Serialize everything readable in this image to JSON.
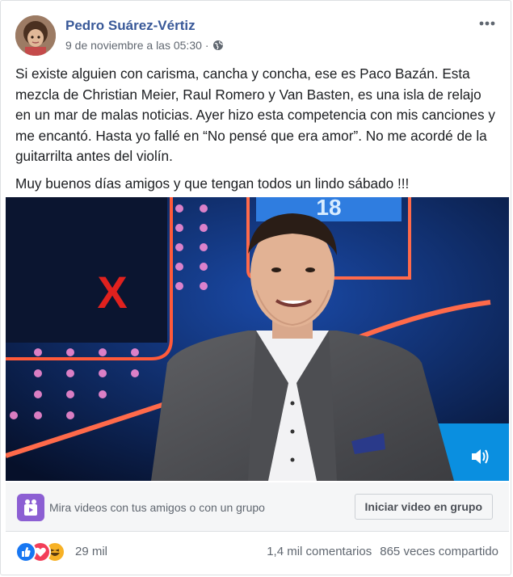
{
  "post": {
    "author": "Pedro Suárez-Vértiz",
    "timestamp": "9 de noviembre a las 05:30",
    "separator": "·",
    "privacy_icon": "globe-icon",
    "more_icon": "more-options-icon",
    "paragraphs": [
      "Si existe alguien con carisma, cancha y concha, ese es Paco Bazán. Esta mezcla de Christian Meier, Raul Romero y Van Basten, es una isla de relajo en un mar de malas noticias. Ayer hizo esta competencia con mis canciones y me encantó. Hasta yo fallé en “No pensé que era amor”. No me acordé de la guitarrilta antes del violín.",
      "Muy buenos días amigos y que tengan todos un lindo sábado !!!"
    ]
  },
  "video": {
    "overlay_number": "18",
    "overlay_x": "X",
    "volume_icon": "volume-icon"
  },
  "watch_party": {
    "icon": "watch-party-icon",
    "text": "Mira videos con tus amigos o con un grupo",
    "button": "Iniciar video en grupo"
  },
  "stats": {
    "reactions": [
      "like",
      "love",
      "haha"
    ],
    "reaction_count": "29 mil",
    "comments": "1,4 mil comentarios",
    "shares": "865 veces compartido"
  },
  "colors": {
    "author_link": "#385898",
    "meta_gray": "#606770",
    "like_blue": "#1877f2",
    "love_red": "#f33e58",
    "haha_yellow": "#f7b125",
    "watch_purple": "#8c5fd3"
  }
}
